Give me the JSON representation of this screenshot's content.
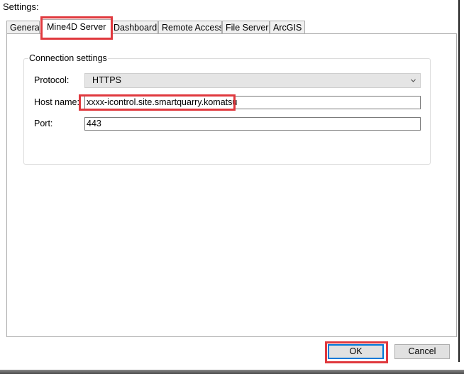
{
  "dialog": {
    "title": "Settings:"
  },
  "tabs": [
    {
      "label": "General",
      "selected": false
    },
    {
      "label": "Mine4D Server",
      "selected": true
    },
    {
      "label": "Dashboard",
      "selected": false
    },
    {
      "label": "Remote Access",
      "selected": false
    },
    {
      "label": "File Server",
      "selected": false
    },
    {
      "label": "ArcGIS",
      "selected": false
    }
  ],
  "connection": {
    "group_title": "Connection settings",
    "protocol": {
      "label": "Protocol:",
      "value": "HTTPS",
      "icon": "chevron-down-icon"
    },
    "host": {
      "label": "Host name:",
      "value": "xxxx-icontrol.site.smartquarry.komatsu"
    },
    "port": {
      "label": "Port:",
      "value": "443"
    }
  },
  "buttons": {
    "ok": "OK",
    "cancel": "Cancel"
  },
  "colors": {
    "highlight": "#e0393e",
    "default_button_border": "#0078d7",
    "combo_background": "#e5e5e5"
  }
}
